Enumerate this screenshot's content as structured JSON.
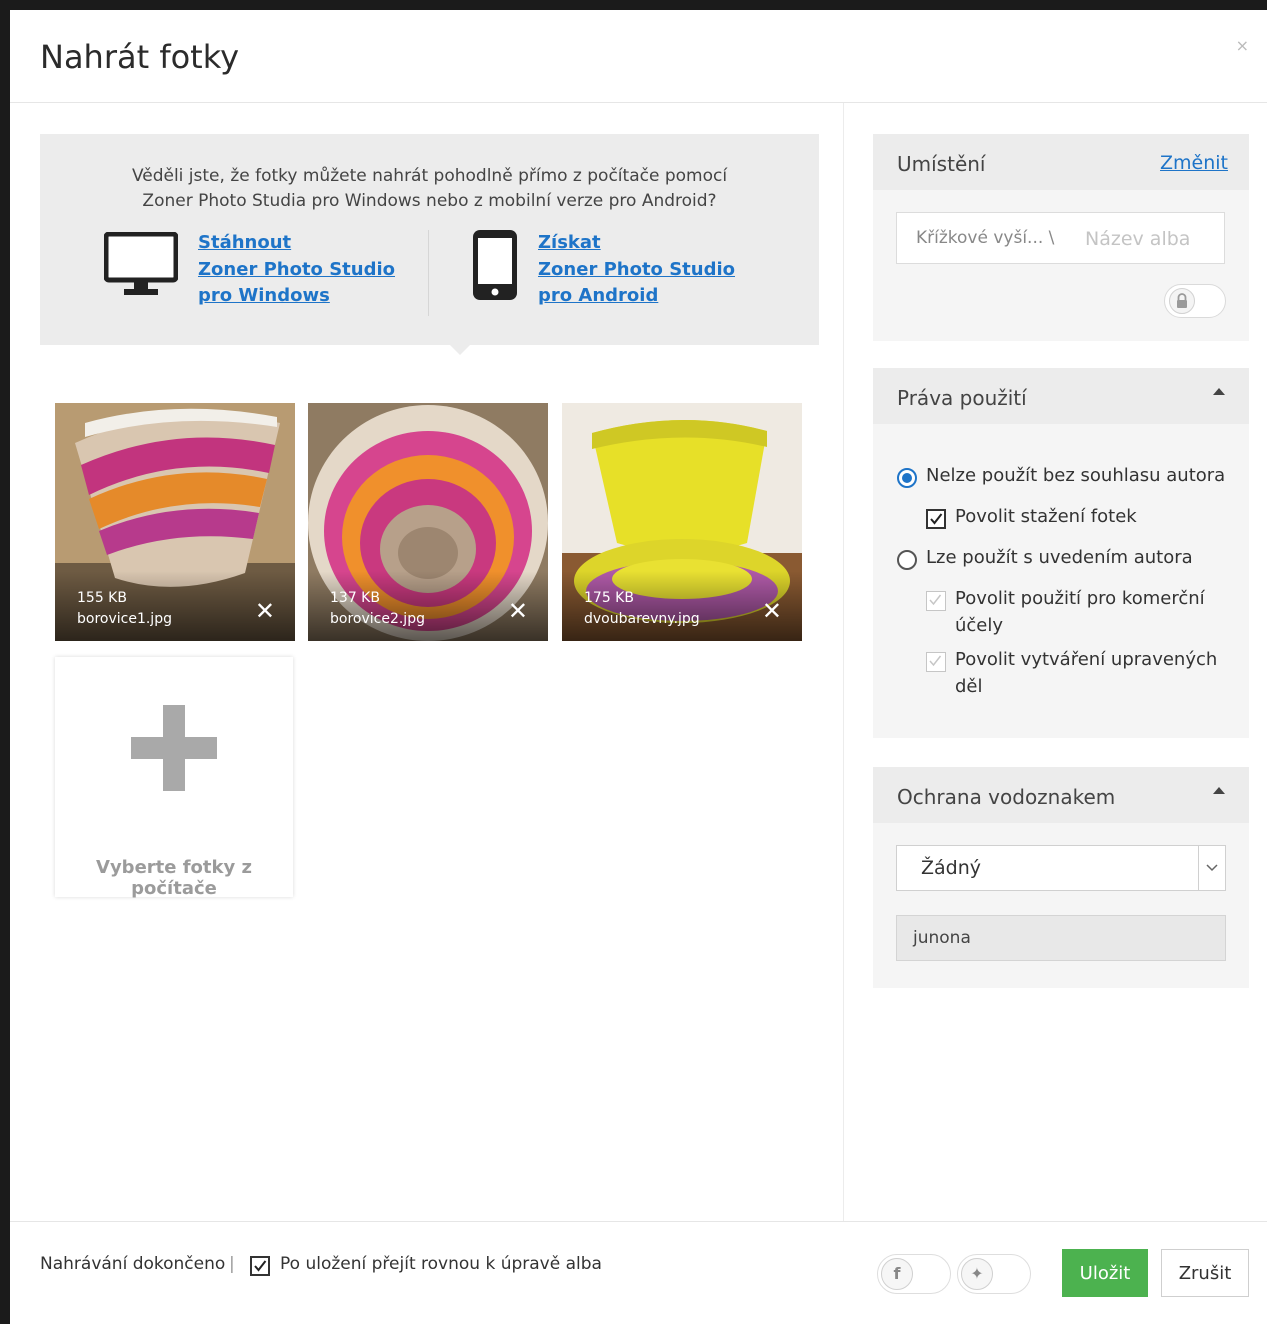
{
  "dialog": {
    "title": "Nahrát fotky",
    "close_label": "×"
  },
  "promo": {
    "text_line1": "Věděli jste, že fotky můžete nahrát pohodlně přímo z počítače pomocí",
    "text_line2": "Zoner Photo Studia pro Windows nebo z mobilní verze pro Android?",
    "windows_link": [
      "Stáhnout",
      "Zoner Photo Studio",
      "pro Windows"
    ],
    "android_link": [
      "Získat",
      "Zoner Photo Studio",
      "pro Android"
    ],
    "windows_icon": "desktop-monitor-icon",
    "android_icon": "smartphone-icon"
  },
  "photos": [
    {
      "size": "155 KB",
      "name": "borovice1.jpg",
      "remove": "✕"
    },
    {
      "size": "137 KB",
      "name": "borovice2.jpg",
      "remove": "✕"
    },
    {
      "size": "175 KB",
      "name": "dvoubarevny.jpg",
      "remove": "✕"
    }
  ],
  "add_tile": {
    "label": "Vyberte fotky z počítače",
    "icon": "plus-icon"
  },
  "location": {
    "title": "Umístění",
    "change_label": "Změnit",
    "path": "Křížkové vyší... \\",
    "album_placeholder": "Název alba",
    "lock_icon": "lock-icon"
  },
  "rights": {
    "title": "Práva použití",
    "option_no_use": "Nelze použít bez souhlasu autora",
    "allow_download": "Povolit stažení fotek",
    "option_attribution": "Lze použít s uvedením autora",
    "allow_commercial_1": "Povolit použití pro komerční",
    "allow_commercial_2": "účely",
    "allow_derivatives_1": "Povolit vytváření upravených",
    "allow_derivatives_2": "děl"
  },
  "watermark": {
    "title": "Ochrana vodoznakem",
    "selected": "Žádný",
    "text": "junona"
  },
  "footer": {
    "status": "Nahrávání dokončeno",
    "separator": "|",
    "goto_album_label": "Po uložení přejít rovnou k úpravě alba",
    "facebook_glyph": "f",
    "twitter_glyph": "✦",
    "save_label": "Uložit",
    "cancel_label": "Zrušit"
  },
  "colors": {
    "accent": "#1e74c8",
    "save": "#4cb24f"
  }
}
